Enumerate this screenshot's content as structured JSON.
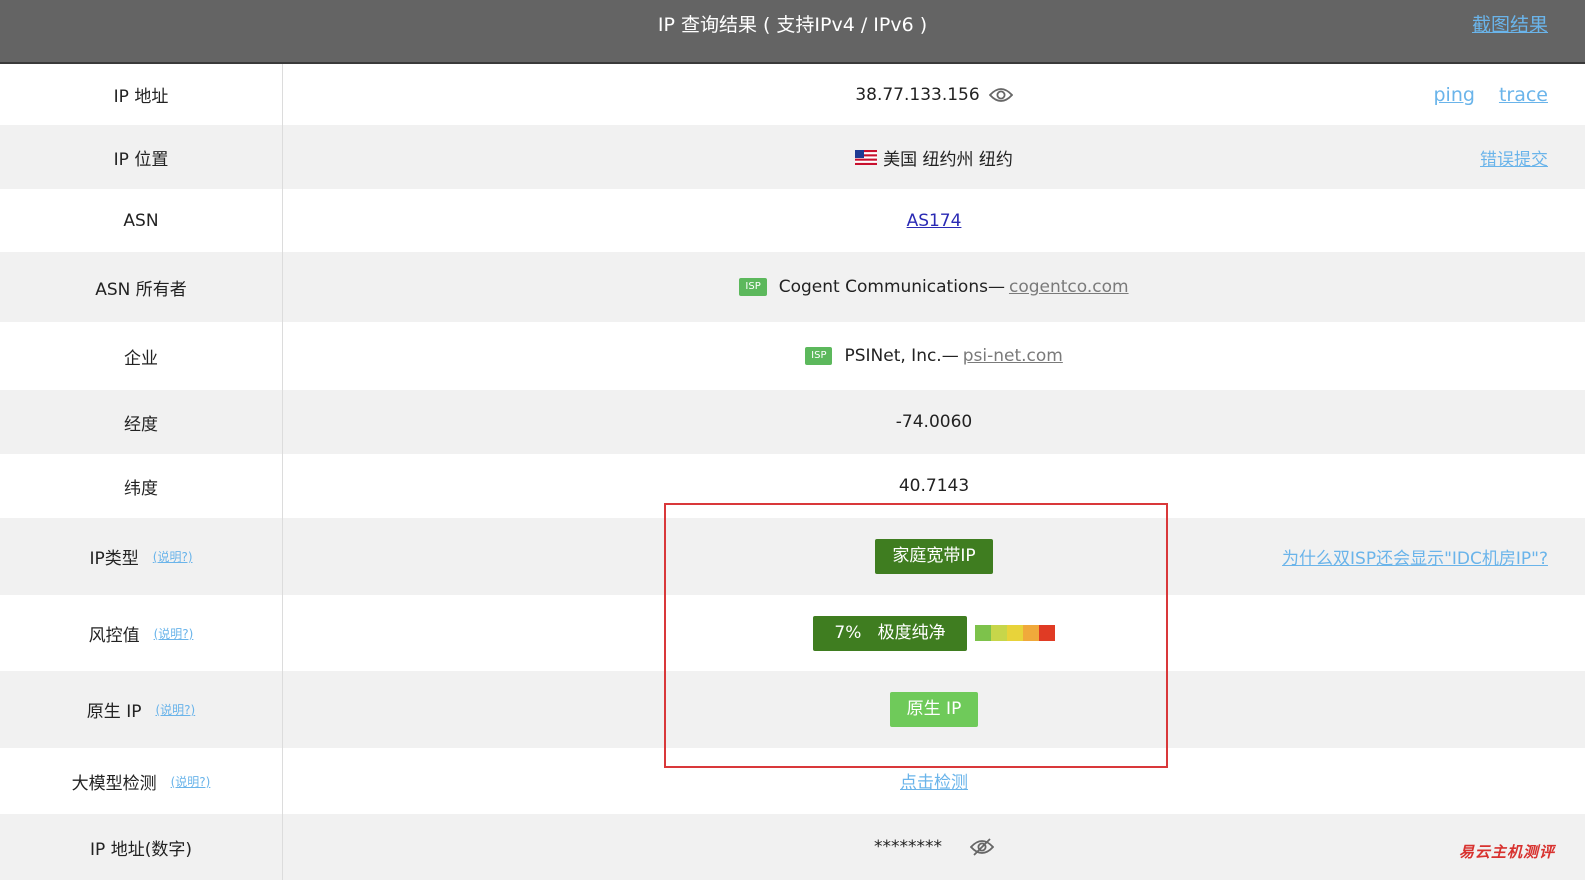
{
  "header": {
    "title": "IP 查询结果 ( 支持IPv4 / IPv6 )",
    "screenshot_link": "截图结果"
  },
  "rows": {
    "ip": {
      "label": "IP 地址",
      "value": "38.77.133.156",
      "ping": "ping",
      "trace": "trace"
    },
    "location": {
      "label": "IP 位置",
      "value": "美国 纽约州 纽约",
      "report_link": "错误提交"
    },
    "asn": {
      "label": "ASN",
      "value": "AS174"
    },
    "asn_owner": {
      "label": "ASN 所有者",
      "badge": "ISP",
      "name": "Cogent Communications—",
      "site": "cogentco.com"
    },
    "company": {
      "label": "企业",
      "badge": "ISP",
      "name": "PSINet, Inc.—",
      "site": "psi-net.com"
    },
    "longitude": {
      "label": "经度",
      "value": "-74.0060"
    },
    "latitude": {
      "label": "纬度",
      "value": "40.7143"
    },
    "ip_type": {
      "label": "IP类型",
      "note": "(说明?)",
      "value": "家庭宽带IP",
      "why_link": "为什么双ISP还会显示\"IDC机房IP\"?"
    },
    "risk": {
      "label": "风控值",
      "note": "(说明?)",
      "percent": "7%",
      "level": "极度纯净",
      "colors": [
        "#7dc24b",
        "#c7d64a",
        "#e8d33a",
        "#f0a93b",
        "#e03b24"
      ]
    },
    "native": {
      "label": "原生 IP",
      "note": "(说明?)",
      "value": "原生 IP"
    },
    "llm": {
      "label": "大模型检测",
      "note": "(说明?)",
      "value": "点击检测"
    },
    "numeric": {
      "label": "IP 地址(数字)",
      "value": "********"
    }
  },
  "icons": {
    "eye": "eye-icon",
    "eye_off": "eye-off-icon",
    "flag": "us-flag-icon"
  },
  "watermark": "易云主机测评"
}
